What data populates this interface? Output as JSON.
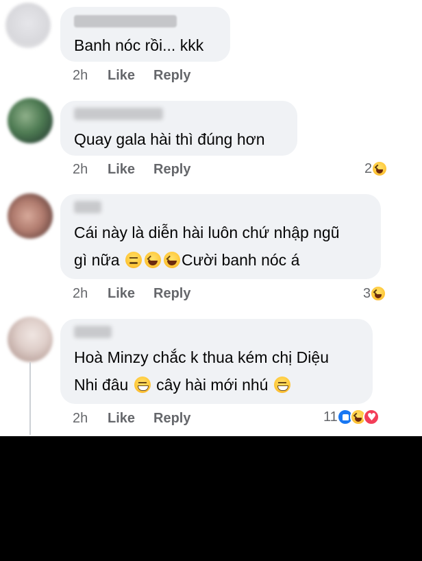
{
  "comments": [
    {
      "text": "Banh nóc rồi... kkk",
      "time": "2h",
      "like_label": "Like",
      "reply_label": "Reply",
      "reaction_count": ""
    },
    {
      "text": "Quay gala hài thì đúng hơn",
      "time": "2h",
      "like_label": "Like",
      "reply_label": "Reply",
      "reaction_count": "2",
      "reaction_icons": [
        "haha-reaction-icon"
      ]
    },
    {
      "text_line1": "Cái này là diễn hài luôn chứ nhập ngũ",
      "text_line2_a": "gì nữa",
      "text_line2_b": "Cười banh nóc á",
      "inline_emojis": [
        "expressionless-emoji",
        "tears-of-joy-emoji",
        "tears-of-joy-emoji"
      ],
      "time": "2h",
      "like_label": "Like",
      "reply_label": "Reply",
      "reaction_count": "3",
      "reaction_icons": [
        "haha-reaction-icon"
      ]
    },
    {
      "text_line1": "Hoà Minzy chắc k thua kém chị Diệu",
      "text_line2_a": "Nhi đâu",
      "text_line2_b": "cây hài mới nhú",
      "inline_emojis": [
        "sweat-smile-emoji",
        "sweat-smile-emoji"
      ],
      "time": "2h",
      "like_label": "Like",
      "reply_label": "Reply",
      "reaction_count": "11",
      "reaction_icons": [
        "like-reaction-icon",
        "haha-reaction-icon",
        "love-reaction-icon"
      ]
    }
  ],
  "colors": {
    "bubble": "#f0f2f5",
    "meta_text": "#65676b",
    "comment_text": "#050505",
    "like_blue": "#1877f2",
    "love_red": "#f33e58"
  }
}
